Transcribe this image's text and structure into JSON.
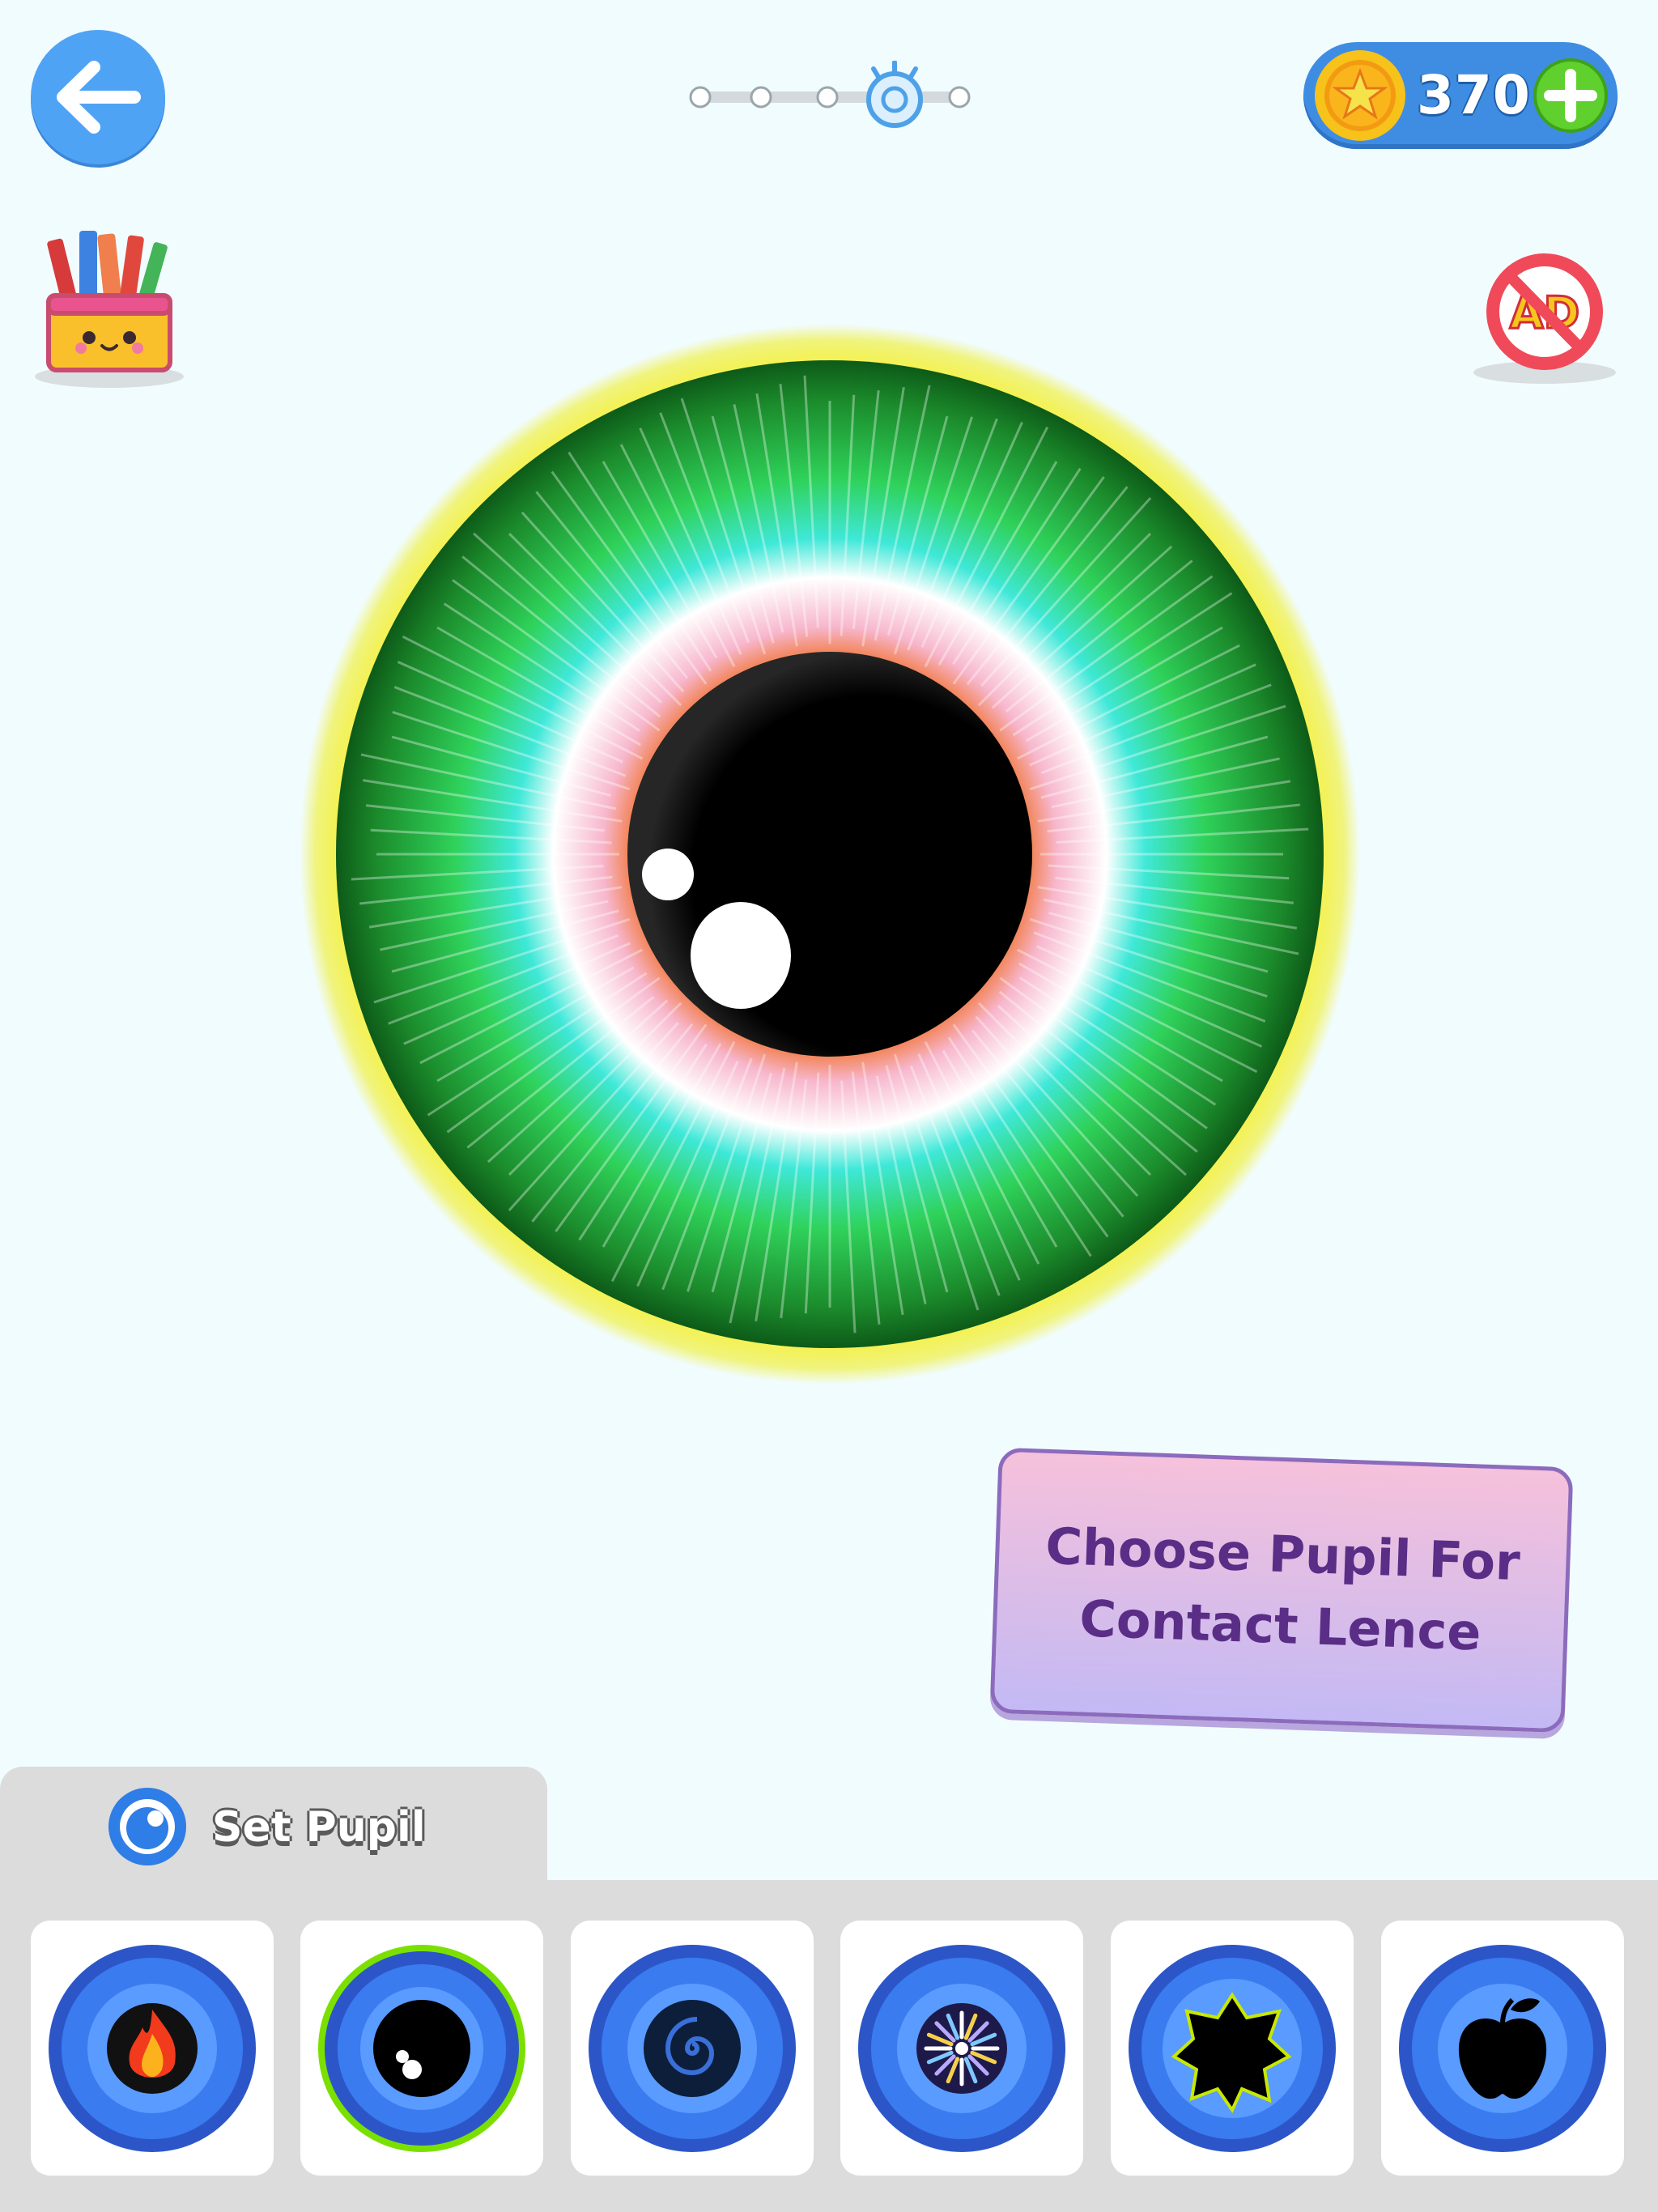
{
  "header": {
    "back_icon": "arrow-left-icon",
    "progress": {
      "total_steps": 5,
      "current_step": 4,
      "current_icon": "eye-icon"
    },
    "coins": {
      "value": "370",
      "icon": "gold-star-coin-icon",
      "add_icon": "plus-icon"
    }
  },
  "side": {
    "left_icon": "crayon-box-icon",
    "right_icon": "no-ads-icon",
    "no_ads_label": "AD"
  },
  "eye": {
    "iris_colors": [
      "#1b8a2b",
      "#2fd25a",
      "#3fe8d8",
      "#f7b6cc",
      "#f06a1c"
    ],
    "pupil_color": "#000000",
    "glow_color": "#f3f23a"
  },
  "hint": {
    "text": "Choose Pupil For Contact Lence"
  },
  "panel": {
    "tab_label": "Set Pupil",
    "tab_icon": "pupil-icon",
    "selected_index": 1,
    "options": [
      {
        "name": "fire",
        "icon": "fire-pupil-icon"
      },
      {
        "name": "classic",
        "icon": "classic-pupil-icon"
      },
      {
        "name": "spiral",
        "icon": "spiral-pupil-icon"
      },
      {
        "name": "firework",
        "icon": "firework-pupil-icon"
      },
      {
        "name": "star-burst",
        "icon": "burst-pupil-icon"
      },
      {
        "name": "apple",
        "icon": "apple-pupil-icon"
      }
    ],
    "accent_color": "#7be000"
  }
}
